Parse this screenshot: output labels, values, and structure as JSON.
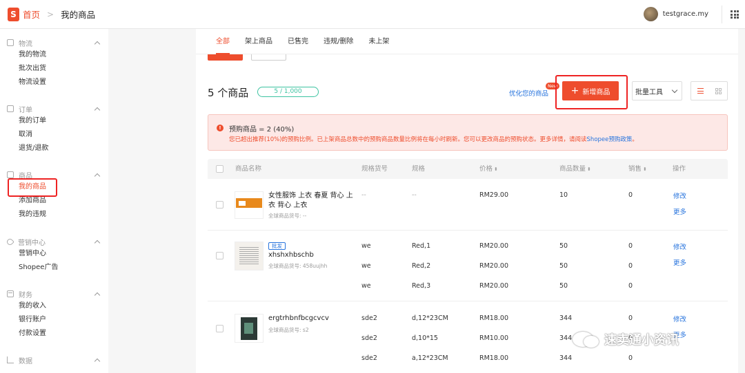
{
  "header": {
    "logo_text": "S",
    "breadcrumb_home": "首页",
    "breadcrumb_sep": ">",
    "breadcrumb_current": "我的商品",
    "username": "testgrace.my"
  },
  "sidebar": {
    "groups": [
      {
        "title": "物流",
        "icon": "truck-icon",
        "items": [
          "我的物流",
          "批次出货",
          "物流设置"
        ]
      },
      {
        "title": "订单",
        "icon": "order-icon",
        "items": [
          "我的订单",
          "取消",
          "退货/退款"
        ]
      },
      {
        "title": "商品",
        "icon": "product-icon",
        "items": [
          "我的商品",
          "添加商品",
          "我的违规"
        ]
      },
      {
        "title": "营销中心",
        "icon": "tag-icon",
        "items": [
          "营销中心",
          "Shopee广告"
        ]
      },
      {
        "title": "财务",
        "icon": "wallet-icon",
        "items": [
          "我的收入",
          "银行账户",
          "付款设置"
        ]
      },
      {
        "title": "数据",
        "icon": "chart-icon",
        "items": []
      }
    ],
    "active_item": "我的商品"
  },
  "tabs": [
    "全部",
    "架上商品",
    "已售完",
    "违规/删除",
    "未上架"
  ],
  "toolbar": {
    "count_label": "5 个商品",
    "quota": "5 / 1,000",
    "optimize_link": "优化您的商品",
    "new_badge": "New",
    "add_button": "新增商品",
    "add_plus": "+",
    "batch_tools": "批量工具"
  },
  "alert": {
    "icon": "!",
    "title": "预购商品 = 2 (40%)",
    "body": "您已超出推荐(10%)的预购比例。已上架商品总数中的预购商品数量比例将在每小时刷新。您可以更改商品的预购状态。更多详情，请阅读",
    "link": "Shopee预购政策",
    "suffix": "。"
  },
  "table": {
    "headers": {
      "name": "商品名称",
      "sku": "规格货号",
      "variation": "规格",
      "price": "价格",
      "stock": "商品数量",
      "sales": "销售",
      "actions": "操作"
    },
    "sort_glyph": "⬍",
    "edit_label": "修改",
    "more_label": "更多",
    "rows": [
      {
        "name_line1": "女性服饰 上衣 春夏 背心 上",
        "name_line2": "衣 背心 上衣",
        "sku_label": "全球商品货号: --",
        "badge": "",
        "variants": [
          {
            "sku": "--",
            "variation": "--",
            "price": "RM29.00",
            "stock": "10",
            "sales": "0"
          }
        ]
      },
      {
        "name_line1": "xhshxhbschb",
        "name_line2": "",
        "sku_label": "全球商品货号: 458uujhh",
        "badge": "批发",
        "variants": [
          {
            "sku": "we",
            "variation": "Red,1",
            "price": "RM20.00",
            "stock": "50",
            "sales": "0"
          },
          {
            "sku": "we",
            "variation": "Red,2",
            "price": "RM20.00",
            "stock": "50",
            "sales": "0"
          },
          {
            "sku": "we",
            "variation": "Red,3",
            "price": "RM20.00",
            "stock": "50",
            "sales": "0"
          }
        ]
      },
      {
        "name_line1": "ergtrhbnfbcgcvcv",
        "name_line2": "",
        "sku_label": "全球商品货号: s2",
        "badge": "",
        "variants": [
          {
            "sku": "sde2",
            "variation": "d,12*23CM",
            "price": "RM18.00",
            "stock": "344",
            "sales": "0"
          },
          {
            "sku": "sde2",
            "variation": "d,10*15",
            "price": "RM10.00",
            "stock": "344",
            "sales": "0"
          },
          {
            "sku": "sde2",
            "variation": "a,12*23CM",
            "price": "RM18.00",
            "stock": "344",
            "sales": "0"
          }
        ]
      }
    ]
  },
  "watermark": "速卖通小资讯",
  "colors": {
    "brand": "#ee4d2d",
    "link": "#2673dd",
    "quota": "#3bc3a0",
    "highlight": "#ee2222"
  }
}
